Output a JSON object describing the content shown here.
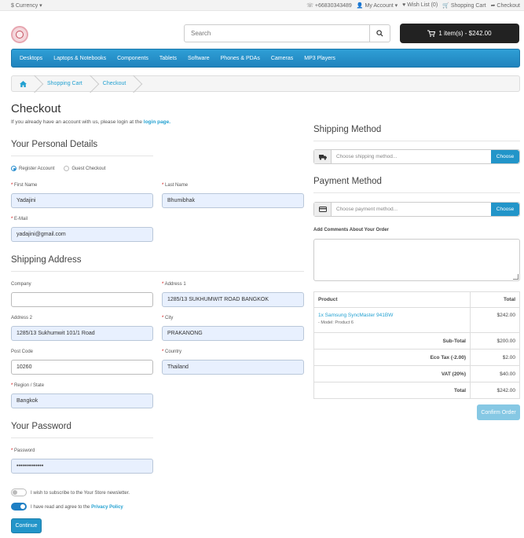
{
  "topbar": {
    "currency": "$ Currency",
    "phone": "+66830343489",
    "my_account": "My Account",
    "wishlist": "Wish List (0)",
    "shopping_cart": "Shopping Cart",
    "checkout": "Checkout"
  },
  "header": {
    "search_placeholder": "Search",
    "cart_label": "1 item(s) - $242.00"
  },
  "nav": [
    "Desktops",
    "Laptops & Notebooks",
    "Components",
    "Tablets",
    "Software",
    "Phones & PDAs",
    "Cameras",
    "MP3 Players"
  ],
  "breadcrumb": [
    "Shopping Cart",
    "Checkout"
  ],
  "page": {
    "title": "Checkout",
    "login_note": "If you already have an account with us, please login at the",
    "login_link": "login page."
  },
  "personal": {
    "title": "Your Personal Details",
    "register": "Register Account",
    "guest": "Guest Checkout",
    "first_name_label": "First Name",
    "first_name": "Yadajini",
    "last_name_label": "Last Name",
    "last_name": "Bhumibhak",
    "email_label": "E-Mail",
    "email": "yadajini@gmail.com"
  },
  "shipping_address": {
    "title": "Shipping Address",
    "company_label": "Company",
    "company": "",
    "address1_label": "Address 1",
    "address1": "1285/13 SUKHUMWIT ROAD BANGKOK",
    "address2_label": "Address 2",
    "address2": "1285/13 Sukhumwit 101/1 Road",
    "city_label": "City",
    "city": "PRAKANONG",
    "postcode_label": "Post Code",
    "postcode": "10260",
    "country_label": "Country",
    "country": "Thailand",
    "region_label": "Region / State",
    "region": "Bangkok"
  },
  "password": {
    "title": "Your Password",
    "label": "Password",
    "value": "••••••••••••••"
  },
  "agreements": {
    "newsletter": "I wish to subscribe to the Your Store newsletter.",
    "privacy_prefix": "I have read and agree to the",
    "privacy_link": "Privacy Policy",
    "continue": "Continue"
  },
  "shipping_method": {
    "title": "Shipping Method",
    "placeholder": "Choose shipping method...",
    "button": "Choose"
  },
  "payment_method": {
    "title": "Payment Method",
    "placeholder": "Choose payment method...",
    "button": "Choose"
  },
  "comments_label": "Add Comments About Your Order",
  "order": {
    "header_product": "Product",
    "header_total": "Total",
    "item_name": "1x Samsung SyncMaster 941BW",
    "item_model": "- Model: Product 6",
    "item_total": "$242.00",
    "totals": [
      {
        "label": "Sub-Total",
        "value": "$200.00"
      },
      {
        "label": "Eco Tax (-2.00)",
        "value": "$2.00"
      },
      {
        "label": "VAT (20%)",
        "value": "$40.00"
      },
      {
        "label": "Total",
        "value": "$242.00"
      }
    ],
    "confirm": "Confirm Order"
  }
}
